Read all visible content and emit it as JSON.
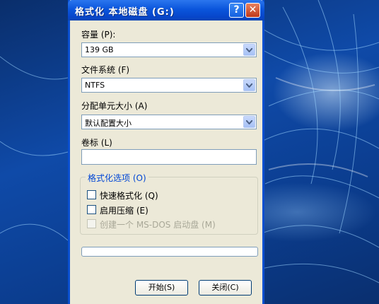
{
  "window": {
    "title": "格式化 本地磁盘 (G:)",
    "help_glyph": "?",
    "close_glyph": "✕"
  },
  "capacity": {
    "label": "容量 (P):",
    "value": "139 GB"
  },
  "filesystem": {
    "label": "文件系统 (F)",
    "value": "NTFS"
  },
  "allocation": {
    "label": "分配单元大小 (A)",
    "value": "默认配置大小"
  },
  "volume_label": {
    "label": "卷标 (L)",
    "value": ""
  },
  "format_options": {
    "legend": "格式化选项 (O)",
    "items": [
      {
        "label": "快速格式化 (Q)",
        "checked": false,
        "enabled": true
      },
      {
        "label": "启用压缩 (E)",
        "checked": false,
        "enabled": true
      },
      {
        "label": "创建一个 MS-DOS 启动盘 (M)",
        "checked": false,
        "enabled": false
      }
    ]
  },
  "progress": {
    "value": 0
  },
  "buttons": {
    "start_label": "开始(S)",
    "close_label": "关闭(C)"
  },
  "icons": {
    "dropdown": "chevron-down-icon",
    "help": "help-icon",
    "close": "close-icon"
  },
  "colors": {
    "titlebar": "#0a55dc",
    "dialog_bg": "#ece9d8",
    "group_legend": "#0046d5",
    "desktop": "#0f4aa8"
  }
}
